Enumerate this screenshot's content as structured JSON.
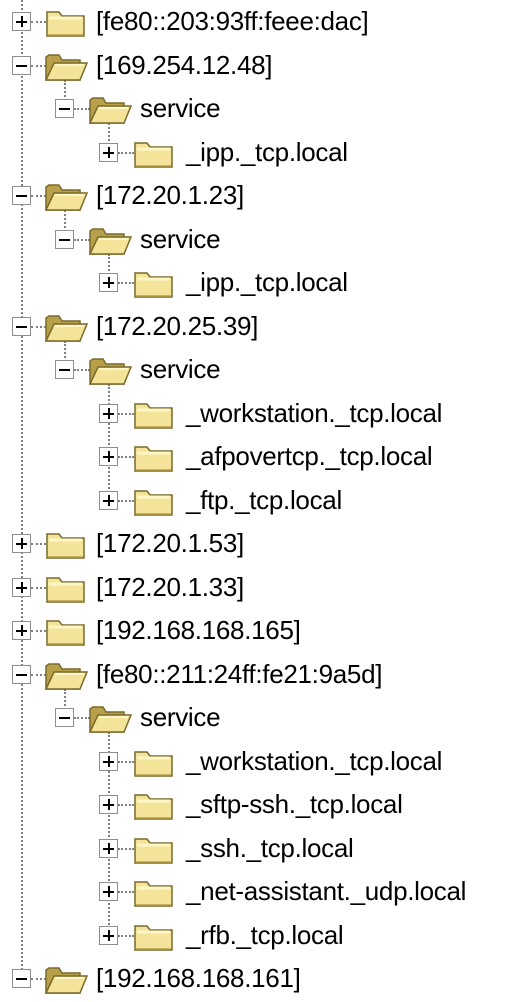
{
  "tree": {
    "nodes": [
      {
        "label": "[fe80::203:93ff:feee:dac]",
        "level": 0,
        "expanded": false,
        "folder": "closed"
      },
      {
        "label": "[169.254.12.48]",
        "level": 0,
        "expanded": true,
        "folder": "open"
      },
      {
        "label": "service",
        "level": 1,
        "expanded": true,
        "folder": "open"
      },
      {
        "label": "_ipp._tcp.local",
        "level": 2,
        "expanded": false,
        "folder": "closed"
      },
      {
        "label": "[172.20.1.23]",
        "level": 0,
        "expanded": true,
        "folder": "open"
      },
      {
        "label": "service",
        "level": 1,
        "expanded": true,
        "folder": "open"
      },
      {
        "label": "_ipp._tcp.local",
        "level": 2,
        "expanded": false,
        "folder": "closed"
      },
      {
        "label": "[172.20.25.39]",
        "level": 0,
        "expanded": true,
        "folder": "open"
      },
      {
        "label": "service",
        "level": 1,
        "expanded": true,
        "folder": "open"
      },
      {
        "label": "_workstation._tcp.local",
        "level": 2,
        "expanded": false,
        "folder": "closed"
      },
      {
        "label": "_afpovertcp._tcp.local",
        "level": 2,
        "expanded": false,
        "folder": "closed"
      },
      {
        "label": "_ftp._tcp.local",
        "level": 2,
        "expanded": false,
        "folder": "closed"
      },
      {
        "label": "[172.20.1.53]",
        "level": 0,
        "expanded": false,
        "folder": "closed"
      },
      {
        "label": "[172.20.1.33]",
        "level": 0,
        "expanded": false,
        "folder": "closed"
      },
      {
        "label": "[192.168.168.165]",
        "level": 0,
        "expanded": false,
        "folder": "closed"
      },
      {
        "label": "[fe80::211:24ff:fe21:9a5d]",
        "level": 0,
        "expanded": true,
        "folder": "open"
      },
      {
        "label": "service",
        "level": 1,
        "expanded": true,
        "folder": "open"
      },
      {
        "label": "_workstation._tcp.local",
        "level": 2,
        "expanded": false,
        "folder": "closed"
      },
      {
        "label": "_sftp-ssh._tcp.local",
        "level": 2,
        "expanded": false,
        "folder": "closed"
      },
      {
        "label": "_ssh._tcp.local",
        "level": 2,
        "expanded": false,
        "folder": "closed"
      },
      {
        "label": "_net-assistant._udp.local",
        "level": 2,
        "expanded": false,
        "folder": "closed"
      },
      {
        "label": "_rfb._tcp.local",
        "level": 2,
        "expanded": false,
        "folder": "closed"
      },
      {
        "label": "[192.168.168.161]",
        "level": 0,
        "expanded": true,
        "folder": "open"
      }
    ]
  },
  "colors": {
    "folder_fill": "#f4e49a",
    "folder_light": "#fdf7c8",
    "folder_outline": "#7a6a2a",
    "folder_dark": "#b8a04a",
    "tree_lines": "#808080",
    "expander_border": "#8e8e8e",
    "text": "#000000"
  },
  "icons": {
    "closed": "folder-closed-icon",
    "open": "folder-open-icon",
    "expand": "plus-expander-icon",
    "collapse": "minus-expander-icon"
  }
}
